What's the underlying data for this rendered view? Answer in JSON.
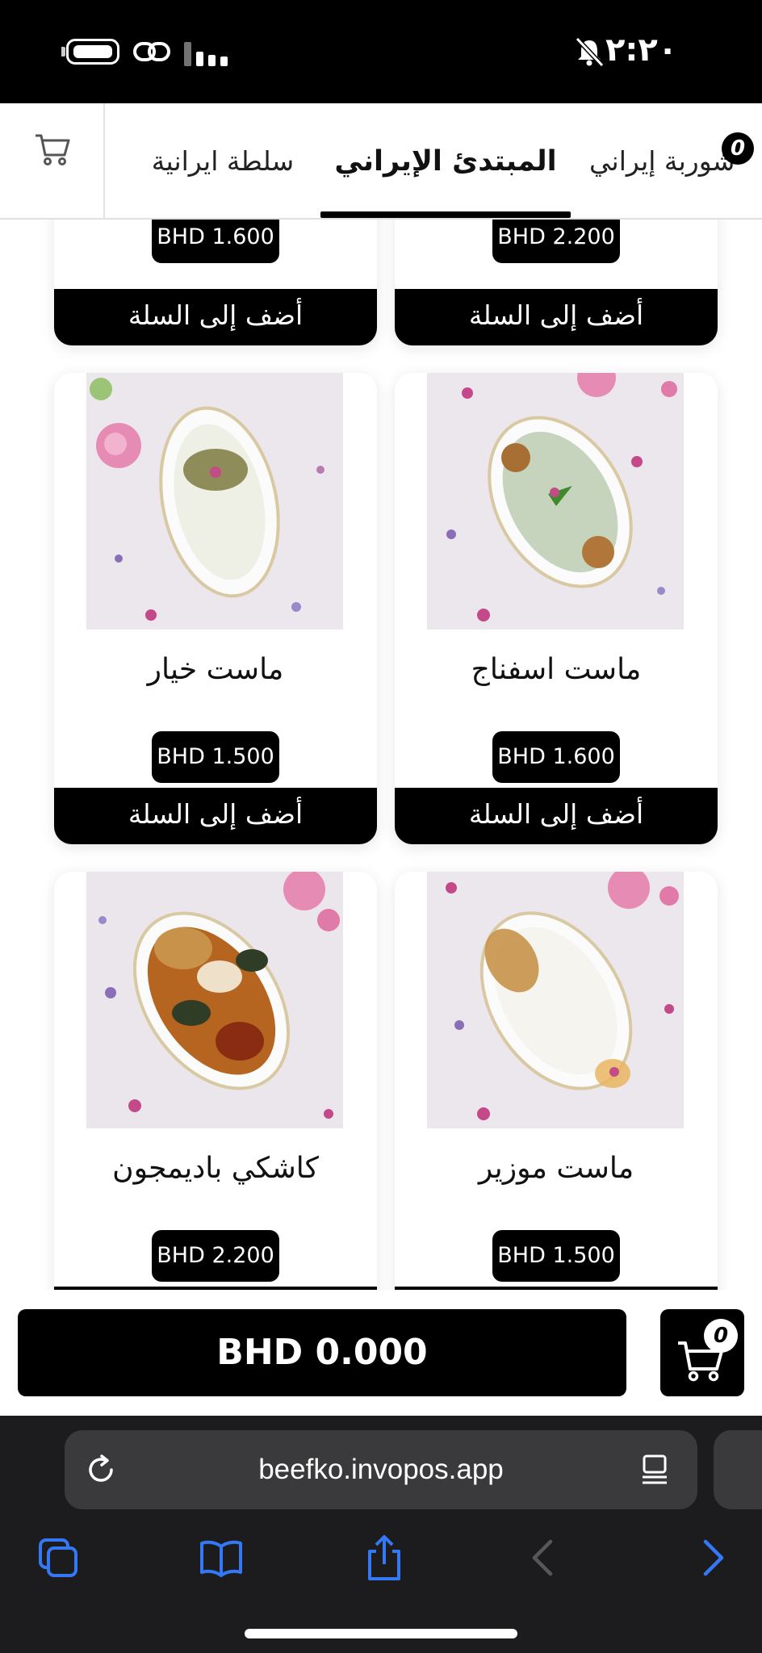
{
  "status_bar": {
    "time": "٢:٢٠"
  },
  "nav": {
    "tabs": [
      {
        "label": "سلطة ايرانية",
        "active": false
      },
      {
        "label": "المبتدئ الإيراني",
        "active": true
      },
      {
        "label": "شوربة إيراني",
        "active": false
      }
    ],
    "cart_count": "0"
  },
  "products_partial": [
    {
      "price": "BHD 1.600",
      "add_label": "أضف إلى السلة"
    },
    {
      "price": "BHD 2.200",
      "add_label": "أضف إلى السلة"
    }
  ],
  "products": [
    {
      "name": "ماست خيار",
      "price": "BHD 1.500",
      "add_label": "أضف إلى السلة"
    },
    {
      "name": "ماست اسفناج",
      "price": "BHD 1.600",
      "add_label": "أضف إلى السلة"
    },
    {
      "name": "كاشكي باديمجون",
      "price": "BHD 2.200"
    },
    {
      "name": "ماست موزير",
      "price": "BHD 1.500"
    }
  ],
  "cart": {
    "total": "BHD 0.000",
    "count": "0"
  },
  "browser": {
    "url": "beefko.invopos.app"
  },
  "colors": {
    "accent": "#000000",
    "ios_blue": "#3478f6"
  }
}
